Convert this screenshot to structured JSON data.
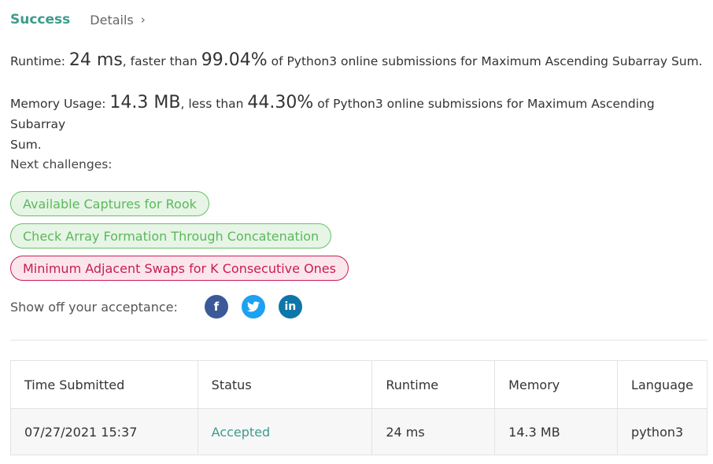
{
  "header": {
    "status": "Success",
    "details_label": "Details",
    "chevron": "›"
  },
  "runtime": {
    "label": "Runtime:",
    "value": "24 ms",
    "mid": ", faster than",
    "percent": "99.04%",
    "suffix": "of Python3 online submissions for Maximum Ascending Subarray Sum."
  },
  "memory": {
    "label": "Memory Usage:",
    "value": "14.3 MB",
    "mid": ", less than",
    "percent": "44.30%",
    "suffix_line1": "of Python3 online submissions for Maximum Ascending Subarray",
    "suffix_line2": "Sum."
  },
  "next": {
    "label": "Next challenges:",
    "challenges": [
      {
        "title": "Available Captures for Rook",
        "difficulty": "easy"
      },
      {
        "title": "Check Array Formation Through Concatenation",
        "difficulty": "easy"
      },
      {
        "title": "Minimum Adjacent Swaps for K Consecutive Ones",
        "difficulty": "hard"
      }
    ]
  },
  "share": {
    "label": "Show off your acceptance:",
    "icons": [
      {
        "name": "facebook-icon",
        "glyph": "f",
        "color": "#3b5998"
      },
      {
        "name": "twitter-icon",
        "glyph": "🐦",
        "color": "#1da1f2"
      },
      {
        "name": "linkedin-icon",
        "glyph": "in",
        "color": "#0e76a8"
      }
    ]
  },
  "table": {
    "headers": [
      "Time Submitted",
      "Status",
      "Runtime",
      "Memory",
      "Language"
    ],
    "rows": [
      [
        "07/27/2021 15:37",
        "Accepted",
        "24 ms",
        "14.3 MB",
        "python3"
      ]
    ]
  },
  "colors": {
    "success": "#3d9c8c",
    "easy_text": "#5cb85c",
    "hard_text": "#c81d55"
  }
}
